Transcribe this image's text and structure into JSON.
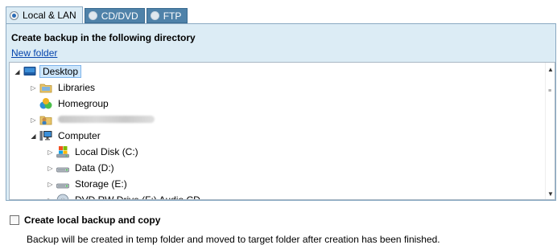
{
  "tabs": [
    {
      "label": "Local & LAN",
      "selected": true
    },
    {
      "label": "CD/DVD",
      "selected": false
    },
    {
      "label": "FTP",
      "selected": false
    }
  ],
  "panel": {
    "title": "Create backup in the following directory",
    "new_folder_link": "New folder"
  },
  "tree": {
    "nodes": [
      {
        "label": "Desktop",
        "icon": "desktop-icon",
        "expanded": true,
        "selected": true
      },
      {
        "label": "Libraries",
        "icon": "libraries-folder-icon",
        "expanded": false
      },
      {
        "label": "Homegroup",
        "icon": "homegroup-icon"
      },
      {
        "label": "",
        "icon": "user-folder-icon",
        "expanded": false,
        "name_blurred": true
      },
      {
        "label": "Computer",
        "icon": "computer-icon",
        "expanded": true
      },
      {
        "label": "Local Disk (C:)",
        "icon": "system-drive-icon",
        "expanded": false
      },
      {
        "label": "Data (D:)",
        "icon": "hard-drive-icon",
        "expanded": false
      },
      {
        "label": "Storage (E:)",
        "icon": "hard-drive-icon",
        "expanded": false
      },
      {
        "label": "DVD RW Drive (F:) Audio CD",
        "icon": "dvd-drive-icon",
        "expanded": false,
        "partially_visible": true
      }
    ]
  },
  "options": {
    "local_copy_label": "Create local backup and copy",
    "local_copy_checked": false,
    "local_copy_description": "Backup will be created in temp folder and moved to target folder after creation has been finished."
  },
  "colors": {
    "panel_bg": "#dcecf5",
    "inactive_tab_bg": "#4f82a9",
    "link": "#0645ad",
    "selection_bg": "#cde6fb"
  }
}
